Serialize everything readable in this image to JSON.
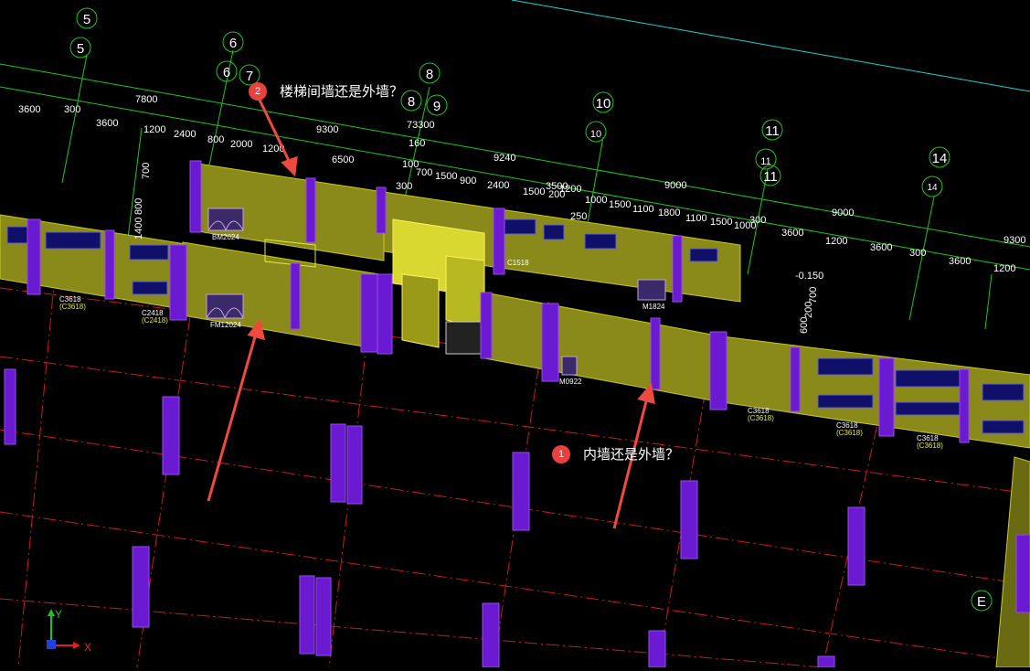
{
  "grid_bubbles_top": [
    "5",
    "5",
    "6",
    "6",
    "7",
    "8",
    "8",
    "9",
    "10",
    "10",
    "11",
    "11",
    "11",
    "14",
    "14"
  ],
  "grid_bubble_right": "E",
  "dims_row1": [
    "7800",
    "9300",
    "9240",
    "9000",
    "9000",
    "9300"
  ],
  "dims_row2": [
    "3600",
    "300",
    "3600",
    "1200",
    "2400",
    "800",
    "2000",
    "1200",
    "6500",
    "100",
    "700",
    "1500",
    "900",
    "2400",
    "1500",
    "200",
    "1200",
    "3500",
    "1000",
    "1500",
    "1100",
    "1800",
    "1100",
    "1500",
    "1000",
    "300",
    "3600",
    "1200",
    "3600",
    "300",
    "3600",
    "1200"
  ],
  "dims_misc": [
    "73300",
    "160",
    "300",
    "250",
    "700",
    "1400",
    "800",
    "600",
    "200",
    "700"
  ],
  "level_mark": "-0.150",
  "window_labels": {
    "c3618_a": "C3618",
    "c3618_a_sub": "(C3618)",
    "c2418": "C2418",
    "c2418_sub": "(C2418)",
    "fm12024": "FM12024",
    "bm2024": "BM2024",
    "m0922": "M0922",
    "m1824": "M1824",
    "c1518": "C1518",
    "c3618_b": "C3618",
    "c3618_b_sub": "(C3618)",
    "c3618_c": "C3618",
    "c3618_c_sub": "(C3618)",
    "c3618_d": "C3618",
    "c3618_d_sub": "(C3618)"
  },
  "callouts": [
    {
      "num": "2",
      "text": "楼梯间墙还是外墙？"
    },
    {
      "num": "1",
      "text": "内墙还是外墙？"
    }
  ],
  "axis": {
    "x": "X",
    "y": "Y"
  },
  "colors": {
    "background": "#000000",
    "wall": "#8a8a1a",
    "column": "#6a1ad0",
    "grid_line": "#18c818",
    "axis_red": "#d01818",
    "window": "#10106a",
    "stair": "#e6e640",
    "callout_arrow": "#f04a3e",
    "callout_badge": "#e8413e"
  }
}
